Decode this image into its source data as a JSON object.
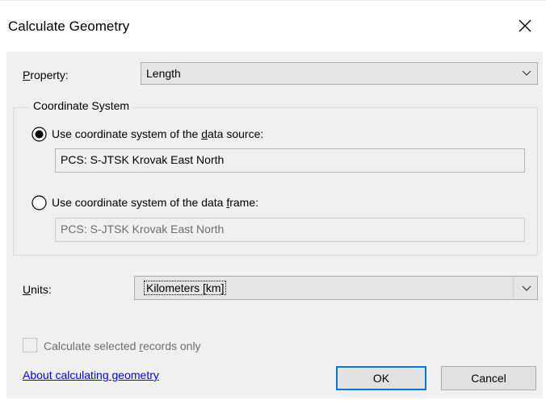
{
  "dialog": {
    "title": "Calculate Geometry",
    "close_icon": "close-icon"
  },
  "property": {
    "label_mnemonic": "P",
    "label_rest": "roperty:",
    "value": "Length"
  },
  "coordinate_system": {
    "legend": "Coordinate System",
    "source_option": {
      "text_before": "Use coordinate system of the ",
      "mnemonic": "d",
      "text_after": "ata source:",
      "selected": true,
      "value": "PCS: S-JTSK Krovak East North"
    },
    "frame_option": {
      "text_before": "Use coordinate system of the data ",
      "mnemonic": "f",
      "text_after": "rame:",
      "selected": false,
      "value": "PCS: S-JTSK Krovak East North"
    }
  },
  "units": {
    "label_mnemonic": "U",
    "label_rest": "nits:",
    "value": "Kilometers [km]"
  },
  "selected_only": {
    "text_before": "Calculate selected ",
    "mnemonic": "r",
    "text_after": "ecords only",
    "checked": false,
    "enabled": false
  },
  "help_link": "About calculating geometry",
  "buttons": {
    "ok": "OK",
    "cancel": "Cancel"
  },
  "colors": {
    "dialog_bg": "#f0f0f0",
    "accent": "#0078d7",
    "link": "#0000ee",
    "disabled_text": "#6d6d6d"
  }
}
